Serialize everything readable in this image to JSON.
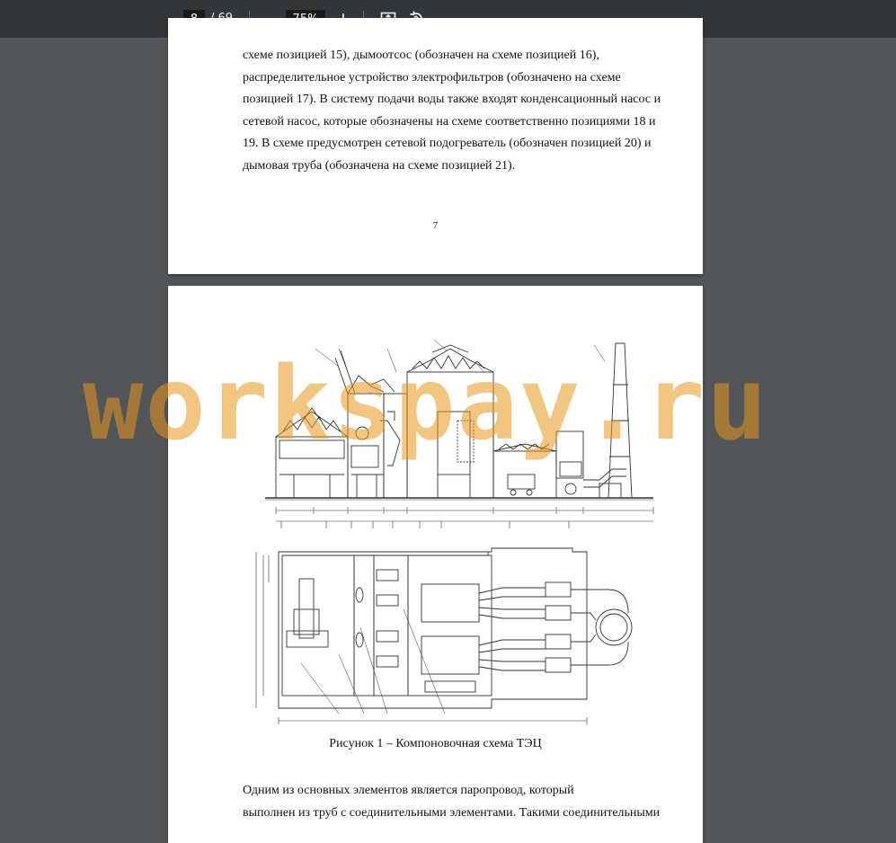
{
  "toolbar": {
    "current_page": "8",
    "page_total": "/ 69",
    "zoom": "75%",
    "zoom_out_symbol": "−",
    "zoom_in_symbol": "+"
  },
  "page_prev": {
    "lines": [
      "схеме позицией 15), дымоотсос (обозначен на схеме позицией 16),",
      "распределительное устройство электрофильтров (обозначено на схеме",
      "позицией 17). В систему подачи воды также входят конденсационный насос и",
      "сетевой насос, которые обозначены на схеме соответственно позициями 18 и",
      "19. В схеме предусмотрен сетевой подогреватель (обозначен позицией 20) и",
      "дымовая труба (обозначена на схеме позицией 21)."
    ],
    "page_number": "7"
  },
  "page_current": {
    "caption": "Рисунок 1 – Компоновочная схема ТЭЦ",
    "lines": [
      "Одним из основных элементов является паропровод, который",
      "выполнен из труб с соединительными элементами. Такими соединительными"
    ]
  },
  "watermark": "workspay.ru",
  "colors": {
    "viewer_bg": "#525659",
    "toolbar_bg": "#323639",
    "watermark": "#e8961a"
  }
}
